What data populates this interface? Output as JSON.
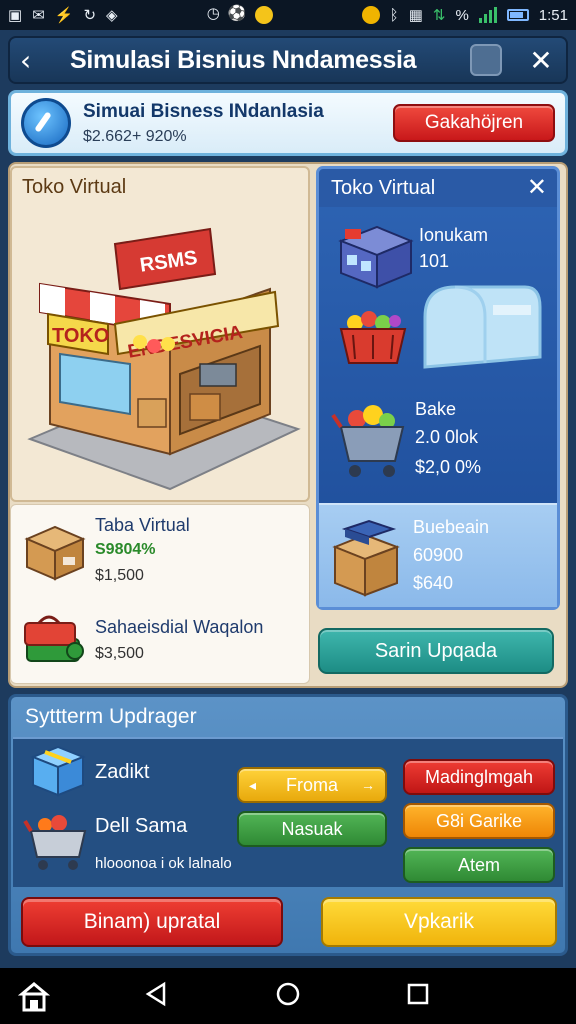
{
  "status_bar": {
    "left_icons": [
      "notification-icon",
      "mail-icon",
      "usb-icon",
      "sync-icon",
      "shield-icon"
    ],
    "right_icons": [
      "clock-icon",
      "soccer-icon",
      "emoji-icon",
      "coin-icon",
      "bluetooth-icon",
      "vibrate-icon",
      "data-icon"
    ],
    "percent_symbol": "%",
    "time": "1:51"
  },
  "header": {
    "back_icon": "back-arrow-icon",
    "title": "Simulasi Bisnius Nndamessia",
    "close_icon": "close-cross-icon"
  },
  "banner": {
    "title": "Simuai Bisness INdanlasia",
    "subtitle": "$2.662+ 920%",
    "button_label": "Gakahöjren"
  },
  "shop_panel": {
    "title": "Toko Virtual",
    "sign_top": "RSMS",
    "sign_left": "TOKO",
    "sign_main": "ENDESVICIA"
  },
  "product_list": [
    {
      "title": "Taba Virtual",
      "highlight": "S9804%",
      "price": "$1,500",
      "icon": "cardboard-box-icon"
    },
    {
      "title": "Sahaeisdial Waqalon",
      "highlight": "",
      "price": "$3,500",
      "icon": "green-cart-icon"
    }
  ],
  "store_panel": {
    "title": "Toko Virtual",
    "close_icon": "close-x-icon",
    "item1": {
      "title": "Ionukam",
      "value": "101",
      "icon": "building-icon"
    },
    "item2": {
      "icon": "basket-icon",
      "aside_icon": "mailbox-icon"
    },
    "item3": {
      "title": "Bake",
      "line2": "2.0 0lok",
      "price": "$2,0 0%",
      "icon": "shopping-cart-icon"
    },
    "item4": {
      "title": "Buebeain",
      "line2": "60900",
      "price": "$640",
      "icon": "box-stack-icon"
    },
    "button_label": "Sarin Upqada"
  },
  "upgrade_panel": {
    "title": "Syttterm Updrager",
    "row1_label": "Zadikt",
    "row2_label": "Dell Sama",
    "footnote": "hlooonoa i ok lalnalo",
    "yellow_button": "Froma",
    "green_button": "Nasuak",
    "red_button": "Madinglmgah",
    "orange_button": "G8i Garike",
    "dark_green_button": "Atem"
  },
  "bottom_buttons": {
    "left": "Binam) upratal",
    "right": "Vpkarik"
  },
  "nav": {
    "home_icon": "home-icon",
    "back_icon": "triangle-back-icon",
    "circle_icon": "circle-home-icon",
    "square_icon": "square-recents-icon"
  },
  "colors": {
    "primary_blue": "#1d4c98",
    "accent_red": "#c8181a",
    "accent_yellow": "#f0b40c",
    "accent_teal": "#1d8d85"
  }
}
